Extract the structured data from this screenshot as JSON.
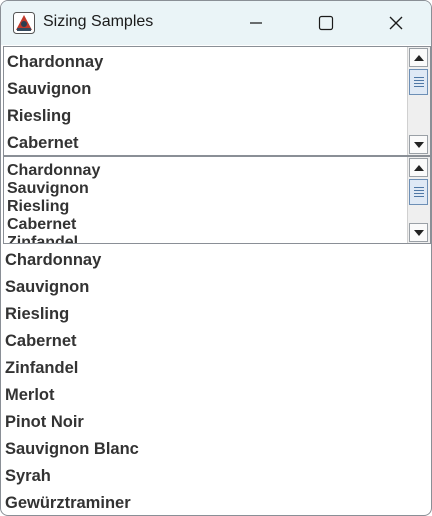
{
  "window": {
    "title": "Sizing Samples"
  },
  "list_top": {
    "items": [
      "Chardonnay",
      "Sauvignon",
      "Riesling",
      "Cabernet"
    ]
  },
  "list_middle": {
    "items": [
      "Chardonnay",
      "Sauvignon",
      "Riesling",
      "Cabernet",
      "Zinfandel"
    ]
  },
  "list_full": {
    "items": [
      "Chardonnay",
      "Sauvignon",
      "Riesling",
      "Cabernet",
      "Zinfandel",
      "Merlot",
      "Pinot Noir",
      "Sauvignon Blanc",
      "Syrah",
      "Gewürztraminer"
    ]
  }
}
